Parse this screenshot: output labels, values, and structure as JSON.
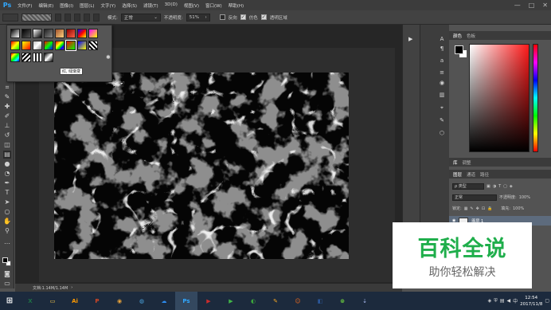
{
  "app": {
    "logo": "Ps"
  },
  "menu": [
    "文件(F)",
    "编辑(E)",
    "图像(I)",
    "图层(L)",
    "文字(Y)",
    "选择(S)",
    "滤镜(T)",
    "3D(D)",
    "视图(V)",
    "窗口(W)",
    "帮助(H)"
  ],
  "window_controls": {
    "minimize": "—",
    "maximize": "□",
    "close": "✕"
  },
  "options": {
    "mode_label": "模式:",
    "mode_value": "正常",
    "opacity_label": "不透明度:",
    "opacity_value": "51%",
    "reverse_label": "反向",
    "dither_label": "仿色",
    "transparency_label": "透明区域"
  },
  "gradient_picker": {
    "tooltip": "红, 绿渐变"
  },
  "status": {
    "doc_size": "文档:1.14M/1.14M"
  },
  "panels": {
    "color_tabs": [
      "颜色",
      "色板"
    ],
    "lib_tabs": [
      "库",
      "调整"
    ],
    "layer_tabs": [
      "图层",
      "通道",
      "路径"
    ],
    "kind_label": "ρ 类型",
    "blend_mode": "正常",
    "opacity_label": "不透明度:",
    "opacity_value": "100%",
    "lock_label": "锁定:",
    "fill_label": "填充:",
    "fill_value": "100%",
    "layer_name": "图层 1"
  },
  "watermark": {
    "title": "百科全说",
    "subtitle": "助你轻松解决"
  },
  "taskbar": {
    "apps": [
      {
        "name": "excel",
        "label": "X",
        "color": "#1e7145"
      },
      {
        "name": "explorer",
        "label": "▭",
        "color": "#f3c54a"
      },
      {
        "name": "illustrator",
        "label": "Ai",
        "color": "#ff9a00"
      },
      {
        "name": "powerpoint",
        "label": "P",
        "color": "#d24726"
      },
      {
        "name": "app5",
        "label": "◉",
        "color": "#e8a23a"
      },
      {
        "name": "app6",
        "label": "◍",
        "color": "#4aa3df"
      },
      {
        "name": "baidu-netdisk",
        "label": "☁",
        "color": "#2d8cf0"
      },
      {
        "name": "photoshop",
        "label": "Ps",
        "color": "#31a8ff"
      },
      {
        "name": "video",
        "label": "▶",
        "color": "#cc2c2c"
      },
      {
        "name": "play",
        "label": "▶",
        "color": "#41b548"
      },
      {
        "name": "browser",
        "label": "◐",
        "color": "#3ba53b"
      },
      {
        "name": "app12",
        "label": "✎",
        "color": "#f5a623"
      },
      {
        "name": "app13",
        "label": "☺",
        "color": "#f26b1d"
      },
      {
        "name": "app14",
        "label": "◧",
        "color": "#2b579a"
      },
      {
        "name": "rss",
        "label": "⊚",
        "color": "#6ccf3f"
      },
      {
        "name": "app16",
        "label": "⇣",
        "color": "#9ad"
      }
    ],
    "clock_time": "12:54",
    "clock_date": "2017/11/8"
  }
}
